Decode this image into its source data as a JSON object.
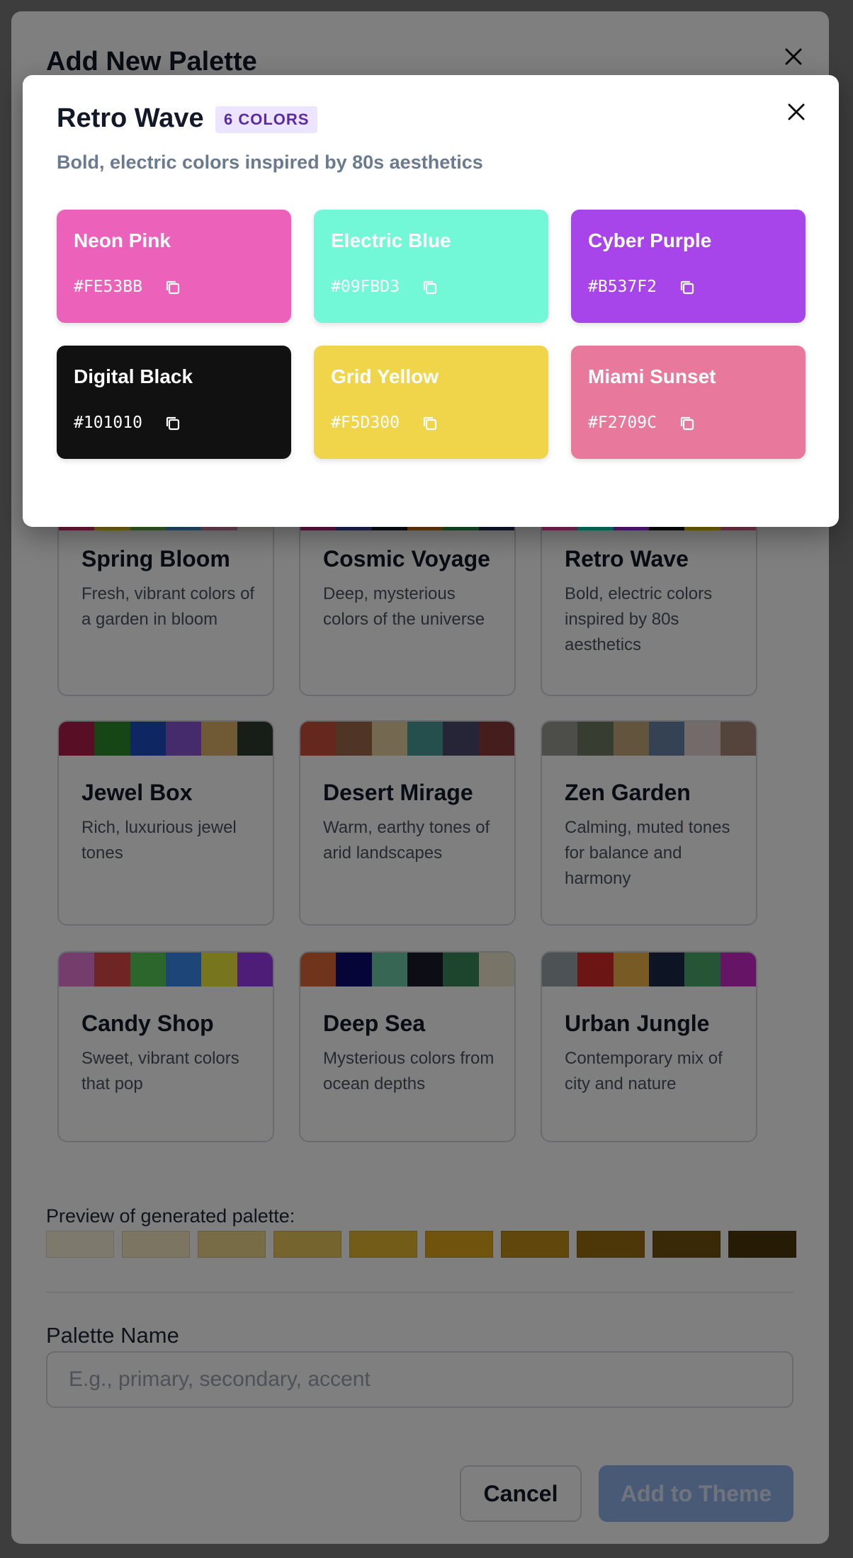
{
  "outer_modal": {
    "title": "Add New Palette",
    "palettes": [
      {
        "name": "Spring Bloom",
        "description": "Fresh, vibrant colors of a garden in bloom",
        "swatches": [
          "#e03a7a",
          "#f6d22b",
          "#6fc94b",
          "#4aa6df",
          "#e58ab0",
          "#f7f0e8"
        ]
      },
      {
        "name": "Cosmic Voyage",
        "description": "Deep, mysterious colors of the universe",
        "swatches": [
          "#c92b8b",
          "#3a4aa8",
          "#111827",
          "#e07b1a",
          "#2fa84f",
          "#1e2a5a"
        ]
      },
      {
        "name": "Retro Wave",
        "description": "Bold, electric colors inspired by 80s aesthetics",
        "swatches": [
          "#FE53BB",
          "#09FBD3",
          "#B537F2",
          "#101010",
          "#F5D300",
          "#F2709C"
        ]
      },
      {
        "name": "Jewel Box",
        "description": "Rich, luxurious jewel tones",
        "swatches": [
          "#b01e4a",
          "#2c8a2c",
          "#1d4fc4",
          "#8a56d6",
          "#e0b46a",
          "#2f3a2f"
        ]
      },
      {
        "name": "Desert Mirage",
        "description": "Warm, earthy tones of arid landscapes",
        "swatches": [
          "#c8503c",
          "#a06a4c",
          "#e6d2a2",
          "#4a9e9a",
          "#4a4a6e",
          "#8a3a3a"
        ]
      },
      {
        "name": "Zen Garden",
        "description": "Calming, muted tones for balance and harmony",
        "swatches": [
          "#9a9a94",
          "#6e7a62",
          "#c4a87a",
          "#6a84a8",
          "#e6d6d4",
          "#a88878"
        ]
      },
      {
        "name": "Candy Shop",
        "description": "Sweet, vibrant colors that pop",
        "swatches": [
          "#e87ad8",
          "#e04a4a",
          "#5acc5a",
          "#3a8aee",
          "#eeea3a",
          "#9a3aee"
        ]
      },
      {
        "name": "Deep Sea",
        "description": "Mysterious colors from ocean depths",
        "swatches": [
          "#e0683a",
          "#0a0a6e",
          "#6ecca8",
          "#1a1a2a",
          "#3a8a5a",
          "#f0ead0"
        ]
      },
      {
        "name": "Urban Jungle",
        "description": "Contemporary mix of city and nature",
        "swatches": [
          "#9aa6aa",
          "#d82a2a",
          "#f0b44a",
          "#1a2a4a",
          "#4aaa6a",
          "#cc2acc"
        ]
      }
    ],
    "preview_label": "Preview of generated palette:",
    "preview_colors": [
      "#fbf3d9",
      "#f8ebc2",
      "#f1d98f",
      "#ecc85e",
      "#e6b830",
      "#e0a91c",
      "#c28e16",
      "#9a6f10",
      "#72520c",
      "#4c3708"
    ],
    "name_label": "Palette Name",
    "name_placeholder": "E.g., primary, secondary, accent",
    "cancel_label": "Cancel",
    "add_label": "Add to Theme"
  },
  "detail_modal": {
    "title": "Retro Wave",
    "badge": "6 COLORS",
    "description": "Bold, electric colors inspired by 80s aesthetics",
    "colors": [
      {
        "name": "Neon Pink",
        "hex": "#FE53BB",
        "bg": "#ec62bb"
      },
      {
        "name": "Electric Blue",
        "hex": "#09FBD3",
        "bg": "#72f8d6"
      },
      {
        "name": "Cyber Purple",
        "hex": "#B537F2",
        "bg": "#a745ea"
      },
      {
        "name": "Digital Black",
        "hex": "#101010",
        "bg": "#111111"
      },
      {
        "name": "Grid Yellow",
        "hex": "#F5D300",
        "bg": "#f0d44a"
      },
      {
        "name": "Miami Sunset",
        "hex": "#F2709C",
        "bg": "#e8789c"
      }
    ]
  }
}
